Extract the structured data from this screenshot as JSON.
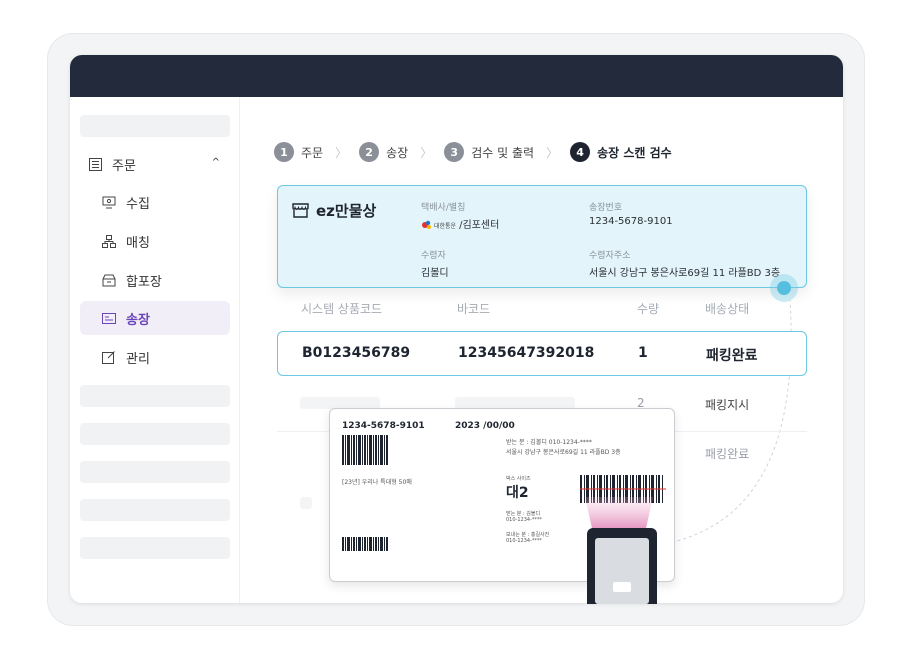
{
  "sidebar": {
    "group": {
      "label": "주문",
      "caret": "^"
    },
    "items": [
      {
        "label": "수집",
        "icon": "monitor-icon"
      },
      {
        "label": "매칭",
        "icon": "hierarchy-icon"
      },
      {
        "label": "합포장",
        "icon": "box-icon"
      },
      {
        "label": "송장",
        "icon": "invoice-icon",
        "active": true
      },
      {
        "label": "관리",
        "icon": "edit-icon"
      }
    ]
  },
  "steps": [
    {
      "num": "1",
      "label": "주문"
    },
    {
      "num": "2",
      "label": "송장"
    },
    {
      "num": "3",
      "label": "검수 및 출력"
    },
    {
      "num": "4",
      "label": "송장 스캔 검수",
      "active": true
    }
  ],
  "info": {
    "brand": "ez만물상",
    "carrier_label": "택배사/별칭",
    "carrier_logo": "CJ",
    "carrier_logo_text": "대한통운",
    "carrier_value": "/김포센터",
    "invoice_label": "송장번호",
    "invoice_value": "1234-5678-9101",
    "recipient_label": "수령자",
    "recipient_value": "김볼디",
    "address_label": "수령자주소",
    "address_value": "서울시 강남구 봉은사로69길 11 라플BD 3층"
  },
  "table": {
    "headers": [
      "시스템 상품코드",
      "바코드",
      "수량",
      "배송상태"
    ],
    "highlight_row": [
      "B0123456789",
      "12345647392018",
      "1",
      "패킹완료"
    ],
    "row2": {
      "qty": "2",
      "status": "패킹지시"
    },
    "row3": {
      "status": "패킹완료"
    }
  },
  "label": {
    "invoice": "1234-5678-9101",
    "date": "2023 /00/00",
    "receiver_line": "받는 분 : 김볼디  010-1234-****",
    "address_line": "서울시 강남구 봉은사로69길 11 라플BD 3층",
    "product_line": "[23년] 우리나 특대형 50매",
    "box_size_label": "박스 사이즈",
    "box_size": "대2",
    "receiver_small": "받는 분 : 김볼디",
    "receiver_phone_small": "010-1234-****",
    "sender_small": "보내는 분 : 홍길사진",
    "sender_phone_small": "010-1234-****"
  },
  "colors": {
    "topbar": "#232a3c",
    "accent": "#6cc8e3",
    "active_nav": "#6b46b8",
    "scanner_beam": "#e8a4c9"
  }
}
